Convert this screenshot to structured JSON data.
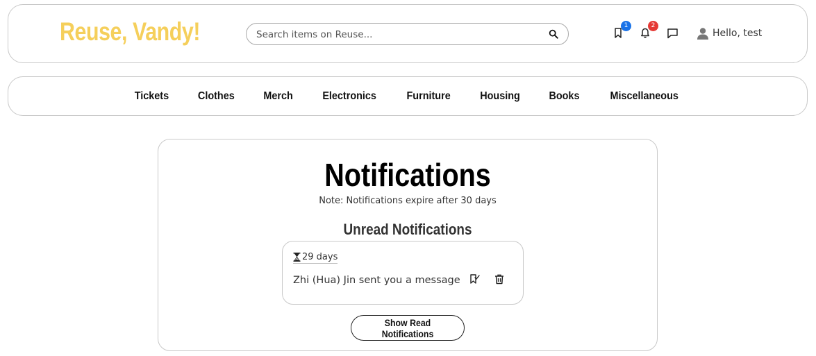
{
  "header": {
    "brand": "Reuse, Vandy!",
    "search": {
      "placeholder": "Search items on Reuse...",
      "value": "",
      "icon": "search-icon"
    },
    "icons": [
      {
        "name": "saved-icon",
        "badge": "1",
        "badge_color": "#1a73e8"
      },
      {
        "name": "bell-icon",
        "badge": "2",
        "badge_color": "#e53935"
      },
      {
        "name": "chat-icon"
      }
    ],
    "user_label": "Hello, test"
  },
  "nav": {
    "items": [
      "Tickets",
      "Clothes",
      "Merch",
      "Electronics",
      "Furniture",
      "Housing",
      "Books",
      "Miscellaneous"
    ]
  },
  "main": {
    "title": "Notifications",
    "note": "Note: Notifications expire after 30 days",
    "section_title": "Unread Notifications",
    "notifications": [
      {
        "expiry": "29 days",
        "message": "Zhi (Hua) Jin sent you a message"
      }
    ],
    "show_read_label": "Show Read Notifications"
  },
  "colors": {
    "brand": "#f5cf5b",
    "border": "#c8c8c8"
  }
}
